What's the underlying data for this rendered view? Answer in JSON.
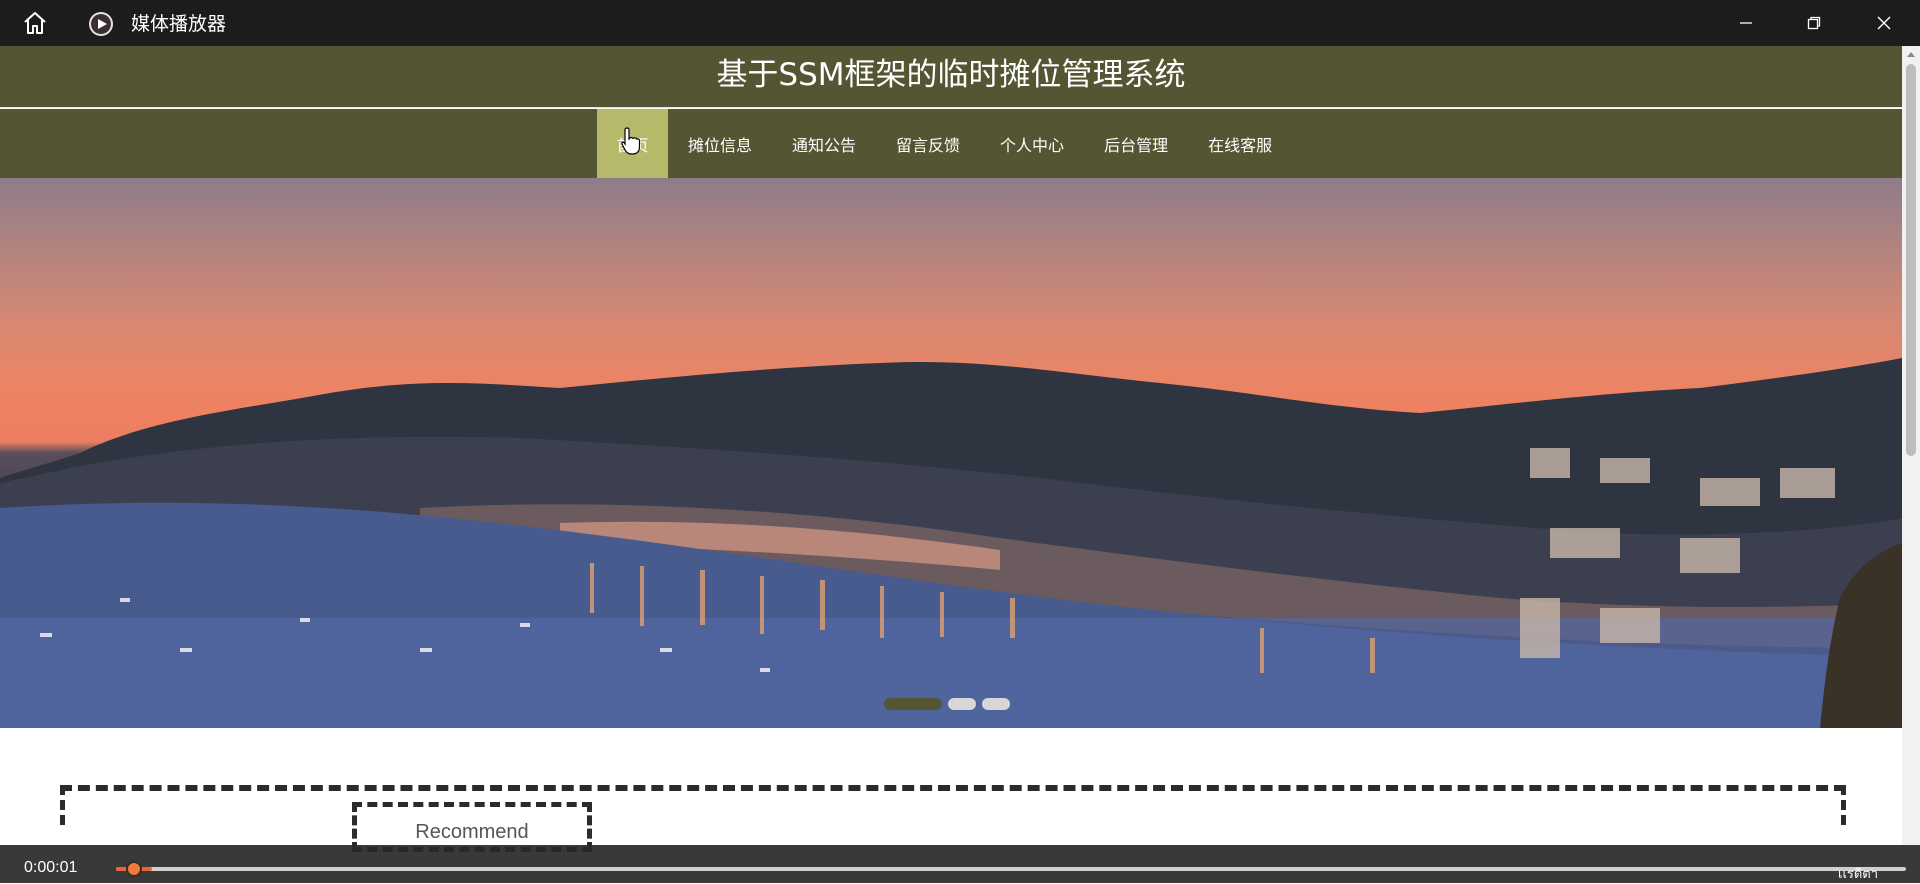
{
  "window": {
    "app_title": "媒体播放器",
    "icons": [
      "home-icon",
      "play-icon",
      "minimize-icon",
      "restore-icon",
      "close-icon"
    ]
  },
  "site": {
    "title": "基于SSM框架的临时摊位管理系统",
    "nav": [
      {
        "label": "首页",
        "active": true
      },
      {
        "label": "摊位信息",
        "active": false
      },
      {
        "label": "通知公告",
        "active": false
      },
      {
        "label": "留言反馈",
        "active": false
      },
      {
        "label": "个人中心",
        "active": false
      },
      {
        "label": "后台管理",
        "active": false
      },
      {
        "label": "在线客服",
        "active": false
      }
    ],
    "carousel": {
      "slides": 3,
      "active_index": 0
    },
    "section_title": "Recommend"
  },
  "player": {
    "elapsed": "0:00:01",
    "progress": 0.006,
    "logo_text": "เเรดิตา"
  },
  "colors": {
    "titlebar": "#1c1c1c",
    "header": "#545533",
    "nav_active": "#b6b96a",
    "progress": "#e8663c"
  }
}
